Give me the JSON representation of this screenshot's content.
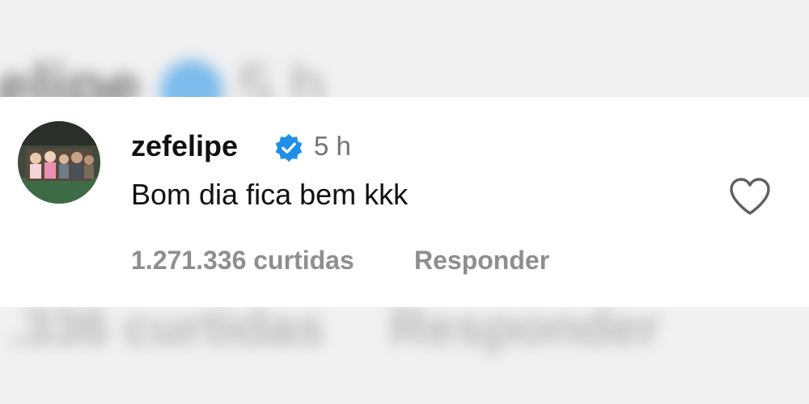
{
  "comment": {
    "username": "zefelipe",
    "time": "5 h",
    "text": "Bom dia fica bem kkk",
    "likes": "1.271.336 curtidas",
    "reply_label": "Responder"
  },
  "background": {
    "name_fragment": "felipe",
    "time_fragment": "5 h",
    "likes_fragment": ".336 curtidas",
    "reply_fragment": "Responder"
  },
  "icons": {
    "verified": "verified-badge-icon",
    "like": "heart-icon"
  },
  "colors": {
    "verified_blue": "#1d8fe8",
    "text": "#111111",
    "muted": "#8e8e8e"
  }
}
